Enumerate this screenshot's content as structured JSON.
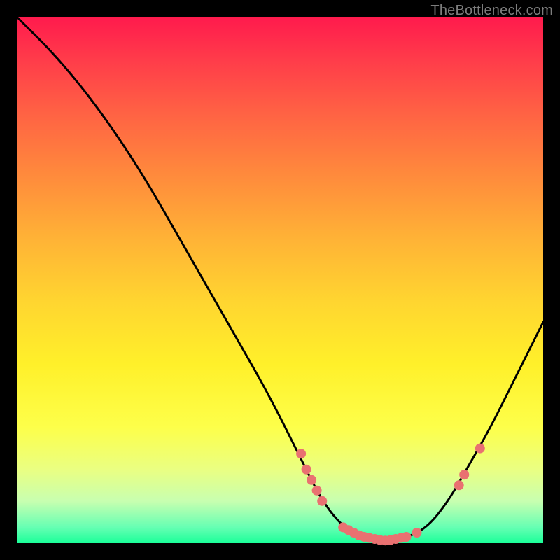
{
  "attribution": "TheBottleneck.com",
  "chart_data": {
    "type": "line",
    "title": "",
    "xlabel": "",
    "ylabel": "",
    "xlim": [
      0,
      100
    ],
    "ylim": [
      0,
      100
    ],
    "curve": [
      {
        "x": 0,
        "y": 100
      },
      {
        "x": 8,
        "y": 92
      },
      {
        "x": 16,
        "y": 82
      },
      {
        "x": 24,
        "y": 70
      },
      {
        "x": 32,
        "y": 56
      },
      {
        "x": 40,
        "y": 42
      },
      {
        "x": 48,
        "y": 28
      },
      {
        "x": 54,
        "y": 16
      },
      {
        "x": 58,
        "y": 8
      },
      {
        "x": 62,
        "y": 3
      },
      {
        "x": 66,
        "y": 1
      },
      {
        "x": 70,
        "y": 0.5
      },
      {
        "x": 74,
        "y": 1
      },
      {
        "x": 78,
        "y": 3
      },
      {
        "x": 82,
        "y": 8
      },
      {
        "x": 86,
        "y": 15
      },
      {
        "x": 90,
        "y": 22
      },
      {
        "x": 94,
        "y": 30
      },
      {
        "x": 98,
        "y": 38
      },
      {
        "x": 100,
        "y": 42
      }
    ],
    "points": [
      {
        "x": 54,
        "y": 17
      },
      {
        "x": 55,
        "y": 14
      },
      {
        "x": 56,
        "y": 12
      },
      {
        "x": 57,
        "y": 10
      },
      {
        "x": 58,
        "y": 8
      },
      {
        "x": 62,
        "y": 3
      },
      {
        "x": 63,
        "y": 2.5
      },
      {
        "x": 64,
        "y": 2
      },
      {
        "x": 65,
        "y": 1.5
      },
      {
        "x": 66,
        "y": 1.2
      },
      {
        "x": 67,
        "y": 1
      },
      {
        "x": 68,
        "y": 0.8
      },
      {
        "x": 69,
        "y": 0.6
      },
      {
        "x": 70,
        "y": 0.5
      },
      {
        "x": 71,
        "y": 0.6
      },
      {
        "x": 72,
        "y": 0.8
      },
      {
        "x": 73,
        "y": 1
      },
      {
        "x": 74,
        "y": 1.2
      },
      {
        "x": 76,
        "y": 2
      },
      {
        "x": 84,
        "y": 11
      },
      {
        "x": 85,
        "y": 13
      },
      {
        "x": 88,
        "y": 18
      }
    ],
    "colors": {
      "curve": "#000000",
      "points": "#e97171"
    }
  }
}
